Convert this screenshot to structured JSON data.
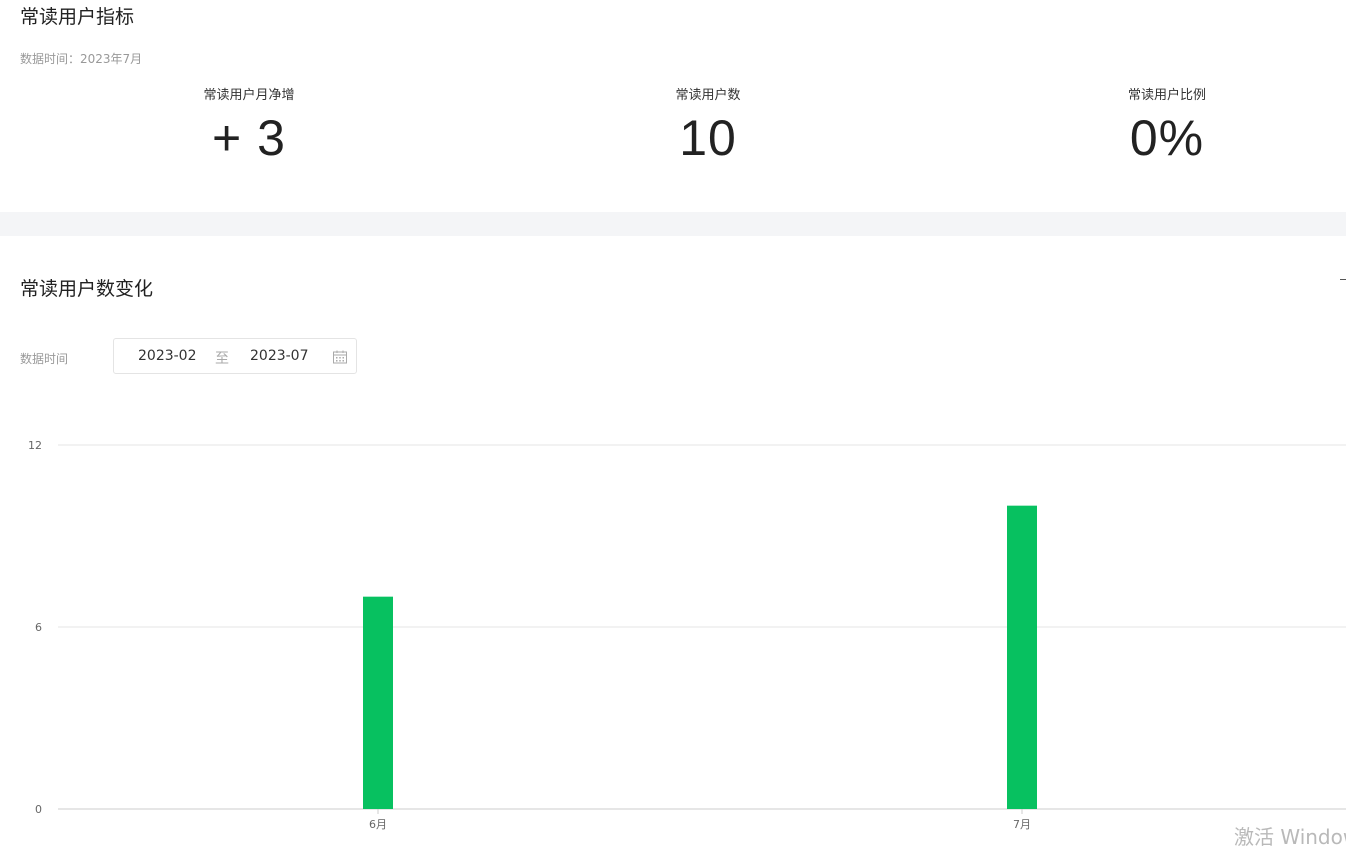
{
  "metrics_section": {
    "title": "常读用户指标",
    "data_time": "数据时间：2023年7月",
    "metrics": [
      {
        "label": "常读用户月净增",
        "value": "+ 3"
      },
      {
        "label": "常读用户数",
        "value": "10"
      },
      {
        "label": "常读用户比例",
        "value": "0%"
      }
    ]
  },
  "trend_section": {
    "title": "常读用户数变化",
    "filter_label": "数据时间",
    "range": {
      "start": "2023-02",
      "separator": "至",
      "end": "2023-07"
    },
    "icon": "calendar-icon"
  },
  "colors": {
    "bar": "#07c160",
    "grid": "#e6e6e6",
    "band": "#f4f5f7"
  },
  "chart_data": {
    "type": "bar",
    "categories": [
      "6月",
      "7月"
    ],
    "values": [
      7,
      10
    ],
    "ylim": [
      0,
      12
    ],
    "yticks": [
      0,
      6,
      12
    ],
    "grid": true,
    "title": "",
    "xlabel": "",
    "ylabel": ""
  },
  "watermark": "激活 Windows"
}
